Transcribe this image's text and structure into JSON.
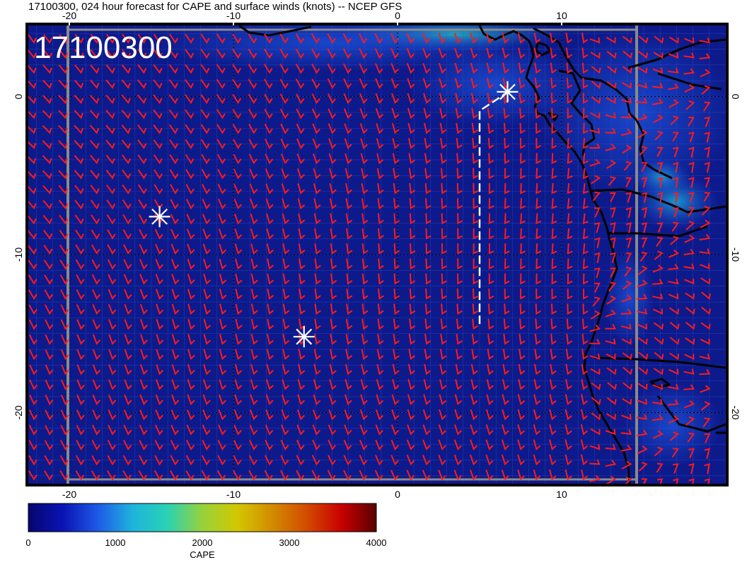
{
  "title": "17100300, 024 hour forecast for CAPE and surface winds (knots) -- NCEP GFS",
  "stamp": "17100300",
  "map": {
    "lon_range": [
      -22.5,
      20
    ],
    "lat_range": [
      -24.5,
      4.5
    ],
    "lon_ticks": [
      "-20",
      "-10",
      "0",
      "10"
    ],
    "lon_tick_values": [
      -20,
      -10,
      0,
      10
    ],
    "lat_ticks": [
      "0",
      "-10",
      "-20"
    ],
    "lat_tick_values": [
      0,
      -10,
      -20
    ],
    "background_color": "#0d1a8c",
    "barb_color": "#ff1a1a",
    "coast_color": "#000000",
    "grid": true
  },
  "markers": [
    {
      "lon": -14.5,
      "lat": -7.6
    },
    {
      "lon": -5.7,
      "lat": -15.2
    },
    {
      "lon": 6.7,
      "lat": 0.3
    }
  ],
  "track": [
    [
      5,
      -14.4
    ],
    [
      5,
      -0.9
    ],
    [
      6.6,
      0.2
    ]
  ],
  "colorbar": {
    "label": "CAPE",
    "min": 0,
    "max": 4000,
    "tick_labels": [
      "0",
      "1000",
      "2000",
      "3000",
      "4000"
    ],
    "tick_values": [
      0,
      1000,
      2000,
      3000,
      4000
    ],
    "colors": [
      "#06066e",
      "#0a14b4",
      "#1e5ae6",
      "#1eb4dc",
      "#2ad2b4",
      "#96d23c",
      "#d2c800",
      "#d28c00",
      "#d24b00",
      "#c80000",
      "#5a0000"
    ]
  }
}
